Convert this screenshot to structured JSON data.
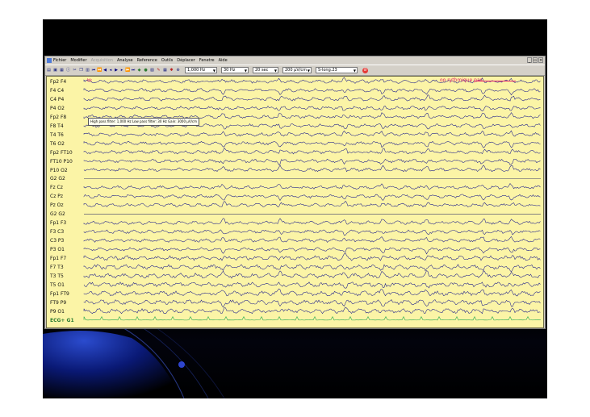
{
  "menu": {
    "items": [
      {
        "label": "Fichier",
        "enabled": true
      },
      {
        "label": "Modifier",
        "enabled": true
      },
      {
        "label": "Acquisition",
        "enabled": false
      },
      {
        "label": "Analyse",
        "enabled": true
      },
      {
        "label": "Reference",
        "enabled": true
      },
      {
        "label": "Outils",
        "enabled": true
      },
      {
        "label": "Déplacer",
        "enabled": true
      },
      {
        "label": "Fenetre",
        "enabled": true
      },
      {
        "label": "Aide",
        "enabled": true
      }
    ],
    "window_buttons": [
      "_",
      "▫",
      "×"
    ]
  },
  "toolbar": {
    "high_pass": "1,000 Hz",
    "low_pass": "30 Hz",
    "timebase": "20 sec",
    "gain": "200 µV/cm",
    "montage": "S-long.23"
  },
  "plot": {
    "tooltip": "High pass filter: 1,000 Hz   Low pass filter: 30 Hz   Gain: 3000 µV/cm",
    "annotation": "oo rythmique pas",
    "marker": "bk",
    "colors": {
      "background": "#fbf4a6",
      "trace": "#1a1a8c",
      "ecg": "#17a34a",
      "annotation": "#e0206a"
    }
  },
  "channels": [
    {
      "label": "Fp2  F4",
      "type": "eeg"
    },
    {
      "label": "F4   C4",
      "type": "eeg"
    },
    {
      "label": "C4   P4",
      "type": "eeg"
    },
    {
      "label": "P4   O2",
      "type": "eeg"
    },
    {
      "label": "Fp2  F8",
      "type": "eeg"
    },
    {
      "label": "F8   T4",
      "type": "eeg"
    },
    {
      "label": "T4   T6",
      "type": "eeg"
    },
    {
      "label": "T6   O2",
      "type": "eeg"
    },
    {
      "label": "Fp2  FT10",
      "type": "eeg"
    },
    {
      "label": "FT10  P10",
      "type": "eeg"
    },
    {
      "label": "P10  O2",
      "type": "eeg"
    },
    {
      "label": "G2 G2",
      "type": "flat"
    },
    {
      "label": "Fz   Cz",
      "type": "eeg"
    },
    {
      "label": "Cz   Pz",
      "type": "eeg"
    },
    {
      "label": "Pz   Oz",
      "type": "eeg"
    },
    {
      "label": "G2 G2",
      "type": "flat"
    },
    {
      "label": "Fp1  F3",
      "type": "eeg"
    },
    {
      "label": "F3   C3",
      "type": "eeg"
    },
    {
      "label": "C3   P3",
      "type": "eeg"
    },
    {
      "label": "P3   O1",
      "type": "eeg"
    },
    {
      "label": "Fp1  F7",
      "type": "eeg"
    },
    {
      "label": "F7   T3",
      "type": "eeg"
    },
    {
      "label": "T3   T5",
      "type": "eeg"
    },
    {
      "label": "T5   O1",
      "type": "eeg"
    },
    {
      "label": "Fp1  FT9",
      "type": "eeg"
    },
    {
      "label": "FT9  P9",
      "type": "eeg"
    },
    {
      "label": "P9   O1",
      "type": "eeg"
    },
    {
      "label": "ECG+  G1",
      "type": "ecg"
    }
  ]
}
